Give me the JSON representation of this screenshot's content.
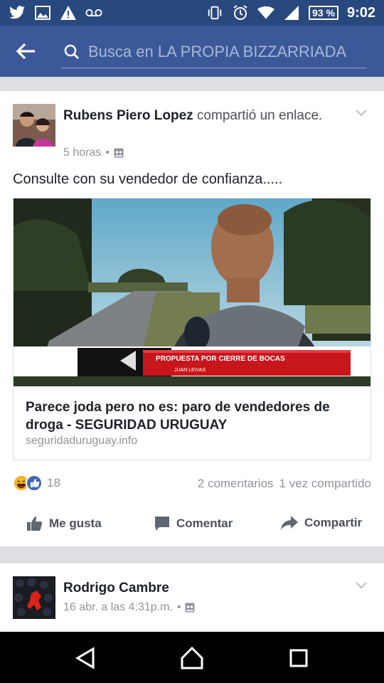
{
  "status_bar": {
    "battery": "93 %",
    "time": "9:02",
    "left_icons": [
      "twitter-icon",
      "image-icon",
      "warning-icon",
      "voicemail-icon"
    ],
    "right_icons": [
      "vibrate-icon",
      "alarm-icon",
      "wifi-icon",
      "signal-icon"
    ]
  },
  "top_bar": {
    "search_placeholder": "Busca en LA PROPIA BIZZARRIADA",
    "color": "#3b5998"
  },
  "post1": {
    "author": "Rubens Piero Lopez",
    "action_text": " compartió un enlace.",
    "time": "5 horas",
    "privacy_icon": "group-icon",
    "text": "Consulte con su vendedor de confianza.....",
    "link": {
      "image_caption_1": "PROPUESTA POR  CIERRE DE BOCAS",
      "image_caption_2": "JUAN LEIVAS",
      "title": "Parece joda pero no es: paro de vendedores de droga - SEGURIDAD URUGUAY",
      "domain": "seguridaduruguay.info"
    },
    "reactions": {
      "count": "18",
      "icons": [
        "haha-icon",
        "like-icon"
      ]
    },
    "comments": "2 comentarios",
    "shares": "1 vez compartido",
    "actions": {
      "like": "Me gusta",
      "comment": "Comentar",
      "share": "Compartir"
    }
  },
  "post2": {
    "author": "Rodrigo Cambre",
    "time": "16 abr. a las 4:31p.m.",
    "privacy_icon": "group-icon"
  },
  "nav_bar": {
    "buttons": [
      "back-triangle-icon",
      "home-icon",
      "recents-icon"
    ]
  }
}
